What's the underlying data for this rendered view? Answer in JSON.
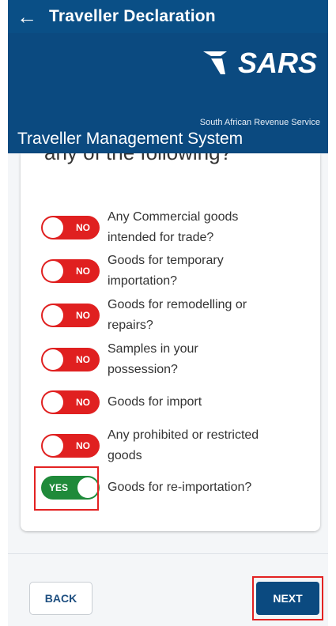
{
  "app_bar": {
    "back_icon": "back-arrow-icon",
    "title": "Traveller Declaration"
  },
  "brand": {
    "logo_text": "SARS",
    "subtitle": "South African Revenue Service",
    "system_title": "Traveller Management System"
  },
  "form": {
    "question": "any of the following?",
    "items": [
      {
        "label_lines": [
          "Any Commercial goods",
          "intended for trade?"
        ],
        "value": "NO"
      },
      {
        "label_lines": [
          "Goods for temporary",
          "importation?"
        ],
        "value": "NO"
      },
      {
        "label_lines": [
          "Goods for remodelling or",
          "repairs?"
        ],
        "value": "NO"
      },
      {
        "label_lines": [
          "Samples in your",
          "possession?"
        ],
        "value": "NO"
      },
      {
        "label_lines": [
          "Goods for import"
        ],
        "value": "NO"
      },
      {
        "label_lines": [
          "Any prohibited or restricted",
          "goods"
        ],
        "value": "NO"
      },
      {
        "label_lines": [
          "Goods for re-importation?"
        ],
        "value": "YES"
      }
    ]
  },
  "footer": {
    "back_label": "BACK",
    "next_label": "NEXT"
  },
  "colors": {
    "primary": "#0b4a80",
    "toggle_no": "#e02020",
    "toggle_yes": "#1f8a3a",
    "highlight": "#e32222"
  }
}
